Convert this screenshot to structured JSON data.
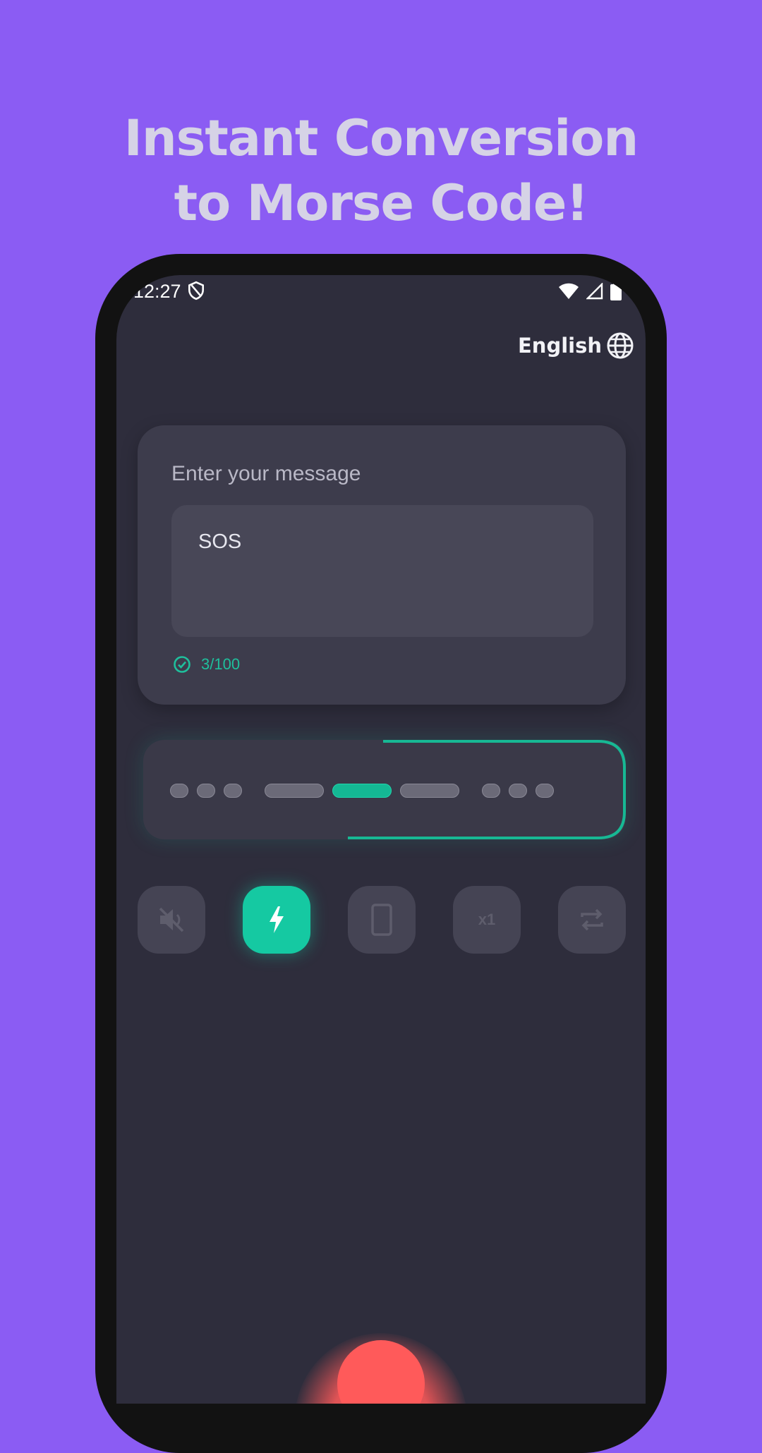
{
  "headline": {
    "line1": "Instant Conversion",
    "line2": "to Morse Code!"
  },
  "status_bar": {
    "time": "12:27",
    "icons": [
      "shield-icon",
      "wifi-icon",
      "signal-icon",
      "battery-icon"
    ]
  },
  "language": {
    "label": "English",
    "icon": "globe-icon"
  },
  "message": {
    "label": "Enter your message",
    "value": "SOS",
    "counter": "3/100",
    "counter_icon": "check-circle-icon"
  },
  "morse": {
    "symbols": [
      "dot",
      "dot",
      "dot",
      "gap",
      "dash",
      "dash",
      "dash",
      "gap",
      "dot",
      "dot",
      "dot"
    ],
    "active_index": 5
  },
  "controls": [
    {
      "name": "sound-off",
      "icon": "speaker-mute-icon",
      "active": false
    },
    {
      "name": "flashlight",
      "icon": "flash-icon",
      "active": true
    },
    {
      "name": "vibration",
      "icon": "phone-icon",
      "active": false
    },
    {
      "name": "speed",
      "label": "x1",
      "active": false
    },
    {
      "name": "repeat",
      "icon": "repeat-icon",
      "active": false
    }
  ],
  "colors": {
    "background": "#8b5cf3",
    "screen": "#2e2d3c",
    "accent": "#15c9a2",
    "record": "#ff5a5a"
  }
}
